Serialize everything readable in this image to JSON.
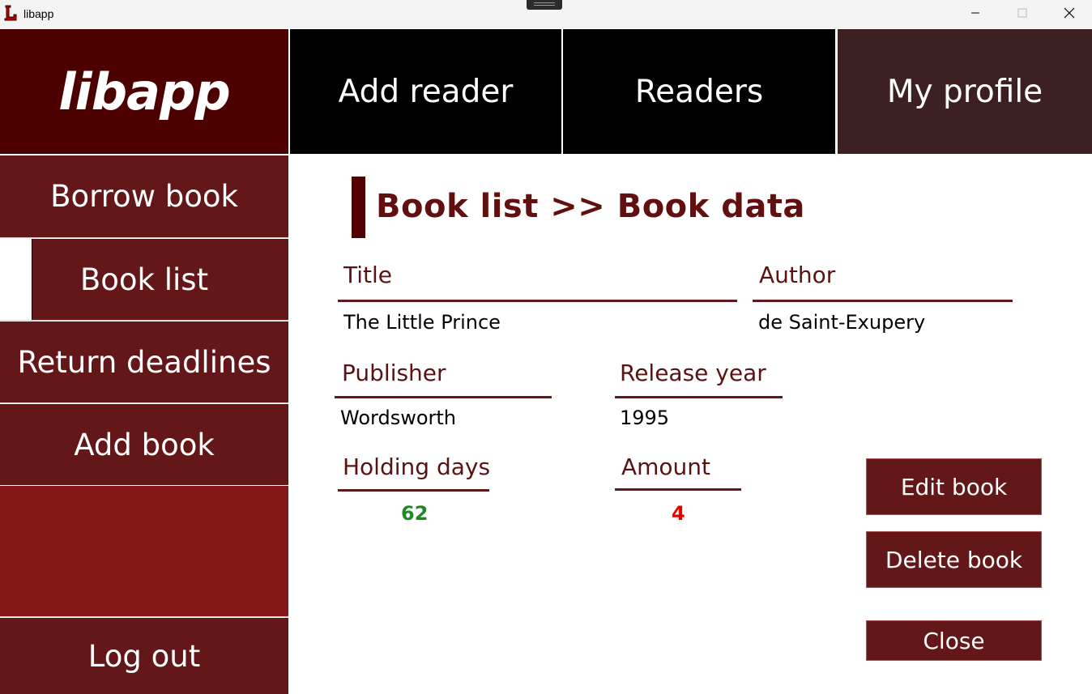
{
  "window": {
    "title": "libapp",
    "icon": "libapp-logo-icon",
    "controls": [
      "minimize-icon",
      "maximize-icon",
      "close-icon"
    ]
  },
  "header": {
    "logo": "libapp",
    "nav": [
      "Add reader",
      "Readers",
      "My profile"
    ]
  },
  "sidebar": {
    "items": [
      "Borrow book",
      "Book list",
      "Return deadlines",
      "Add book"
    ],
    "logout": "Log out",
    "active": "Book list"
  },
  "breadcrumb": "Book list >> Book data",
  "book": {
    "title_label": "Title",
    "title": "The Little Prince",
    "author_label": "Author",
    "author": "de Saint-Exupery",
    "publisher_label": "Publisher",
    "publisher": "Wordsworth",
    "year_label": "Release year",
    "year": "1995",
    "holding_label": "Holding days",
    "holding_days": "62",
    "amount_label": "Amount",
    "amount": "4"
  },
  "buttons": {
    "edit": "Edit book",
    "delete": "Delete book",
    "close": "Close"
  },
  "colors": {
    "brand_dark": "#4c0000",
    "sidebar": "#631718",
    "holding_value": "#1f8a1f",
    "amount_value": "#e60000"
  }
}
